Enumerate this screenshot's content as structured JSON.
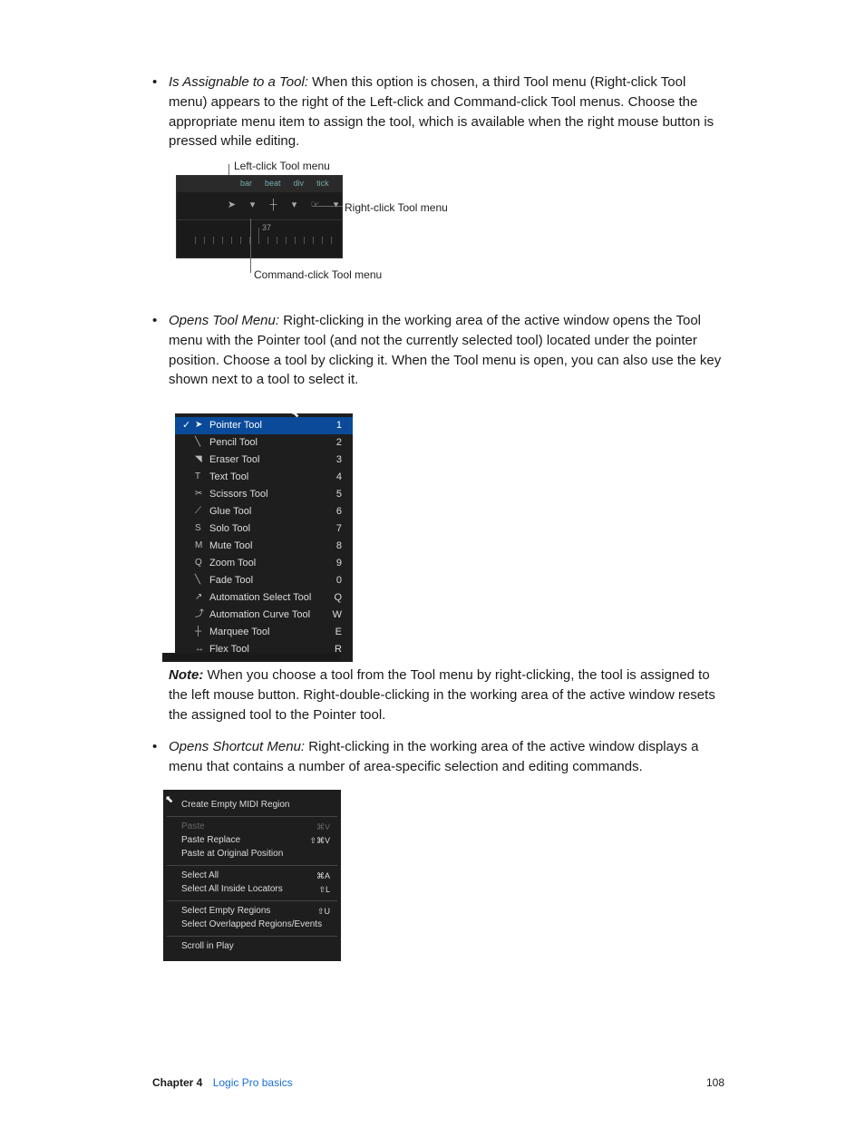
{
  "bullets": {
    "b1_label": "Is Assignable to a Tool:",
    "b1_text": " When this option is chosen, a third Tool menu (Right-click Tool menu) appears to the right of the Left-click and Command-click Tool menus. Choose the appropriate menu item to assign the tool, which is available when the right mouse button is pressed while editing.",
    "b2_label": "Opens Tool Menu:",
    "b2_text": " Right-clicking in the working area of the active window opens the Tool menu with the Pointer tool (and not the currently selected tool) located under the pointer position. Choose a tool by clicking it. When the Tool menu is open, you can also use the key shown next to a tool to select it.",
    "note_label": "Note:",
    "note_text": "  When you choose a tool from the Tool menu by right-clicking, the tool is assigned to the left mouse button. Right-double-clicking in the working area of the active window resets the assigned tool to the Pointer tool.",
    "b3_label": "Opens Shortcut Menu:",
    "b3_text": " Right-clicking in the working area of the active window displays a menu that contains a number of area-specific selection and editing commands."
  },
  "fig1": {
    "top_label": "Left-click Tool menu",
    "right_label": "Right-click Tool menu",
    "bottom_label": "Command-click Tool menu",
    "header": [
      "bar",
      "beat",
      "div",
      "tick"
    ],
    "ruler_num": "37"
  },
  "tool_menu": [
    {
      "icon": "➤",
      "name": "Pointer Tool",
      "key": "1",
      "sel": true
    },
    {
      "icon": "╲",
      "name": "Pencil Tool",
      "key": "2",
      "sel": false
    },
    {
      "icon": "◥",
      "name": "Eraser Tool",
      "key": "3",
      "sel": false
    },
    {
      "icon": "T",
      "name": "Text Tool",
      "key": "4",
      "sel": false
    },
    {
      "icon": "✂",
      "name": "Scissors Tool",
      "key": "5",
      "sel": false
    },
    {
      "icon": "⟋",
      "name": "Glue Tool",
      "key": "6",
      "sel": false
    },
    {
      "icon": "S",
      "name": "Solo Tool",
      "key": "7",
      "sel": false
    },
    {
      "icon": "M",
      "name": "Mute Tool",
      "key": "8",
      "sel": false
    },
    {
      "icon": "Q",
      "name": "Zoom Tool",
      "key": "9",
      "sel": false
    },
    {
      "icon": "╲",
      "name": "Fade Tool",
      "key": "0",
      "sel": false
    },
    {
      "icon": "↗",
      "name": "Automation Select Tool",
      "key": "Q",
      "sel": false
    },
    {
      "icon": "⤴",
      "name": "Automation Curve Tool",
      "key": "W",
      "sel": false
    },
    {
      "icon": "┼",
      "name": "Marquee Tool",
      "key": "E",
      "sel": false
    },
    {
      "icon": "↔",
      "name": "Flex Tool",
      "key": "R",
      "sel": false
    }
  ],
  "shortcut_menu": {
    "g1": [
      {
        "t": "Create Empty MIDI Region",
        "k": ""
      }
    ],
    "g2": [
      {
        "t": "Paste",
        "k": "⌘V",
        "dim": true
      },
      {
        "t": "Paste Replace",
        "k": "⇧⌘V"
      },
      {
        "t": "Paste at Original Position",
        "k": ""
      }
    ],
    "g3": [
      {
        "t": "Select All",
        "k": "⌘A"
      },
      {
        "t": "Select All Inside Locators",
        "k": "⇧L"
      }
    ],
    "g4": [
      {
        "t": "Select Empty Regions",
        "k": "⇧U"
      },
      {
        "t": "Select Overlapped Regions/Events",
        "k": ""
      }
    ],
    "g5": [
      {
        "t": "Scroll in Play",
        "k": ""
      }
    ]
  },
  "footer": {
    "chapter_label": "Chapter  4",
    "chapter_title": "Logic Pro basics",
    "page": "108"
  }
}
